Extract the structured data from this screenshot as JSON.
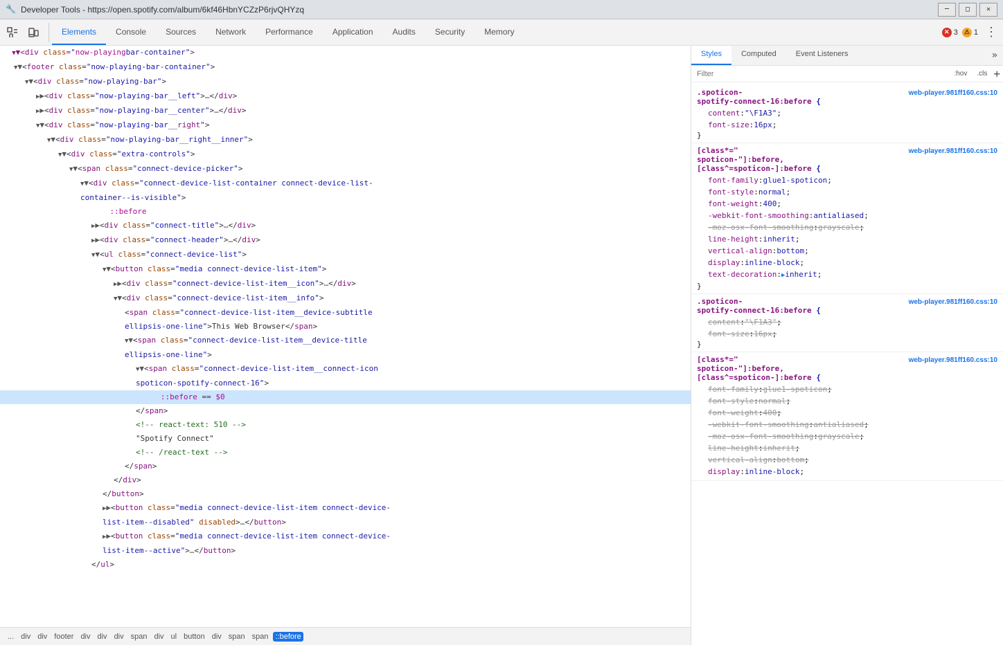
{
  "titlebar": {
    "title": "Developer Tools - https://open.spotify.com/album/6kf46HbnYCZzP6rjvQHYzq",
    "icon": "🔧"
  },
  "toolbar": {
    "tabs": [
      {
        "label": "Elements",
        "active": false
      },
      {
        "label": "Console",
        "active": false
      },
      {
        "label": "Sources",
        "active": false
      },
      {
        "label": "Network",
        "active": false
      },
      {
        "label": "Performance",
        "active": false
      },
      {
        "label": "Application",
        "active": false
      },
      {
        "label": "Audits",
        "active": false
      },
      {
        "label": "Security",
        "active": false
      },
      {
        "label": "Memory",
        "active": false
      }
    ],
    "errors": {
      "count": 3,
      "warnings": 1
    }
  },
  "styles_tabs": [
    {
      "label": "Styles",
      "active": true
    },
    {
      "label": "Computed",
      "active": false
    },
    {
      "label": "Event Listeners",
      "active": false
    }
  ],
  "filter": {
    "placeholder": "Filter"
  },
  "breadcrumb": [
    {
      "label": "...",
      "active": false
    },
    {
      "label": "div",
      "active": false
    },
    {
      "label": "div",
      "active": false
    },
    {
      "label": "footer",
      "active": false
    },
    {
      "label": "div",
      "active": false
    },
    {
      "label": "div",
      "active": false
    },
    {
      "label": "div",
      "active": false
    },
    {
      "label": "span",
      "active": false
    },
    {
      "label": "div",
      "active": false
    },
    {
      "label": "ul",
      "active": false
    },
    {
      "label": "button",
      "active": false
    },
    {
      "label": "div",
      "active": false
    },
    {
      "label": "span",
      "active": false
    },
    {
      "label": "span",
      "active": false
    },
    {
      "label": "::before",
      "active": true
    }
  ]
}
